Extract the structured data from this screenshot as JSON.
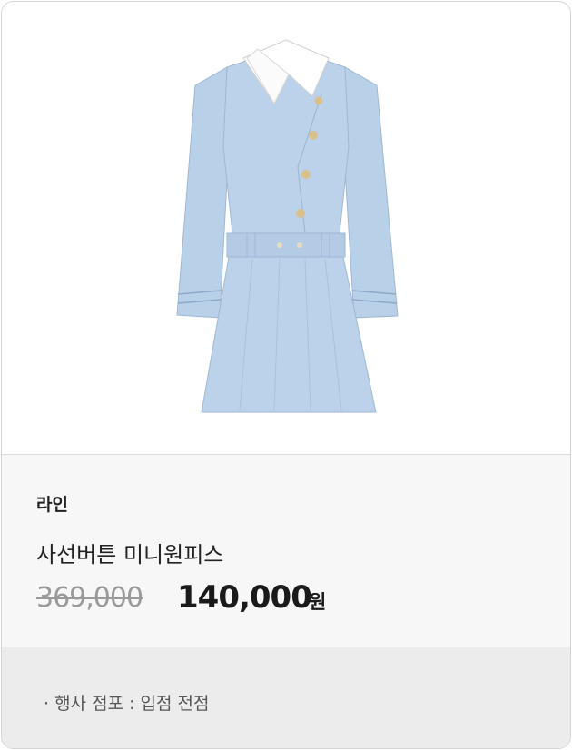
{
  "product": {
    "image_alt": "light blue mini dress with white collar",
    "brand": "라인",
    "name": "사선버튼 미니원피스",
    "original_price": "369,000",
    "sale_price": "140,000",
    "currency_unit": "원"
  },
  "event": {
    "text": "· 행사 점포 : 입점 전점"
  },
  "colors": {
    "dress": "#b8cfe8",
    "collar": "#ffffff",
    "info_bg": "#f7f7f7",
    "event_bg": "#ececec"
  }
}
